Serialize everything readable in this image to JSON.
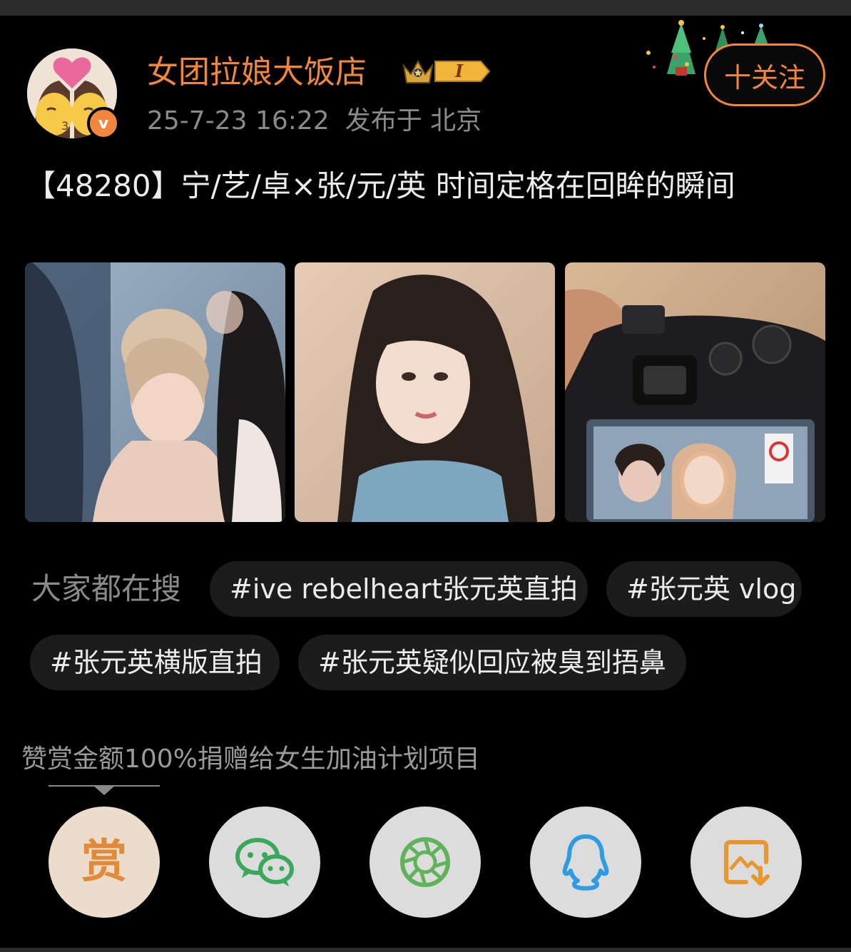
{
  "post": {
    "author": "女团拉娘大饭店",
    "level_badge": "I",
    "timestamp": "25-7-23 16:22",
    "location": "发布于 北京",
    "follow_label": "十关注",
    "title": "【48280】宁/艺/卓×张/元/英 时间定格在回眸的瞬间"
  },
  "search": {
    "label": "大家都在搜",
    "chips": [
      "#ive rebelheart张元英直拍",
      "#张元英 vlog",
      "#张元英横版直拍",
      "#张元英疑似回应被臭到捂鼻"
    ]
  },
  "reward": {
    "note": "赞赏金额100%捐赠给女生加油计划项目",
    "glyph": "赏"
  },
  "share_icons": [
    "reward-icon",
    "wechat-icon",
    "moments-icon",
    "qq-icon",
    "save-image-icon"
  ],
  "colors": {
    "accent": "#f0873c",
    "background": "#000000",
    "chip_bg": "#1c1c1c",
    "text_primary": "#ececec",
    "text_secondary": "#8a8a8a"
  }
}
